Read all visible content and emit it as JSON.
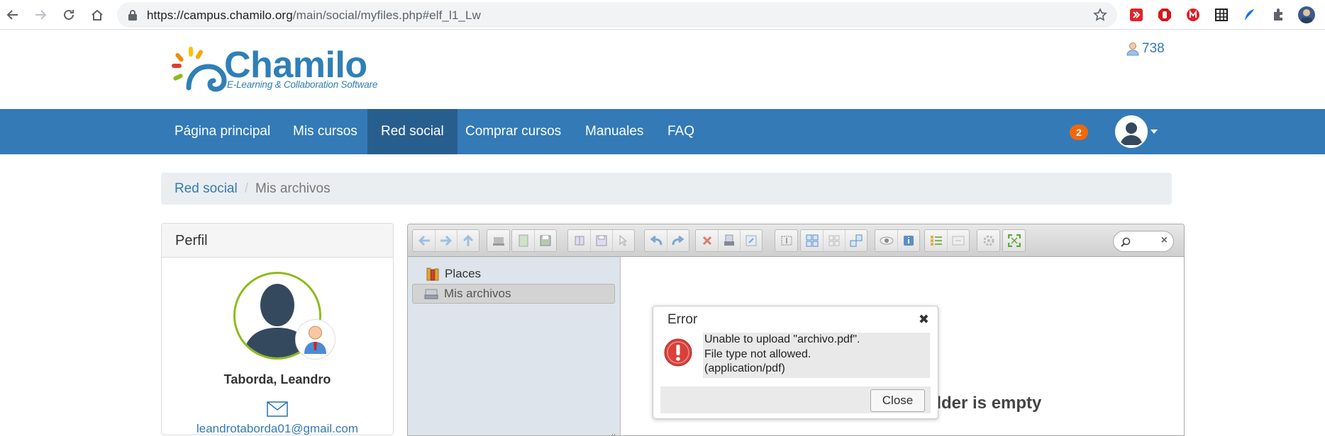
{
  "browser": {
    "url_host": "https://campus.chamilo.org",
    "url_path": "/main/social/myfiles.php#elf_l1_Lw"
  },
  "site": {
    "logo_word": "Chamilo",
    "logo_tagline": "E-Learning & Collaboration Software",
    "online_users": "738"
  },
  "nav": {
    "items": [
      {
        "label": "Página principal"
      },
      {
        "label": "Mis cursos"
      },
      {
        "label": "Red social"
      },
      {
        "label": "Comprar cursos"
      },
      {
        "label": "Manuales"
      },
      {
        "label": "FAQ"
      }
    ],
    "active_index": 2,
    "notification_count": "2"
  },
  "breadcrumb": {
    "parent": "Red social",
    "separator": "/",
    "current": "Mis archivos"
  },
  "profile": {
    "title": "Perfil",
    "name": "Taborda, Leandro",
    "email": "leandrotaborda01@gmail.com"
  },
  "filemanager": {
    "tree": {
      "places": "Places",
      "selected": "Mis archivos"
    },
    "empty_text": "Folder is empty"
  },
  "dialog": {
    "title": "Error",
    "close_symbol": "✖",
    "message_line1": "Unable to upload \"archivo.pdf\".",
    "message_line2": "File type not allowed.",
    "message_line3": "(application/pdf)",
    "button": "Close"
  },
  "colors": {
    "brand_blue": "#337ab7",
    "nav_active": "#285e8e",
    "notif_orange": "#f0680a",
    "error_red": "#d9403a",
    "avatar_ring": "#8dbb1a"
  },
  "icons": [
    "back-icon",
    "forward-icon",
    "reload-icon",
    "home-icon",
    "lock-icon",
    "star-icon",
    "extension-icon",
    "user-icon",
    "mail-icon",
    "error-icon",
    "search-icon"
  ]
}
